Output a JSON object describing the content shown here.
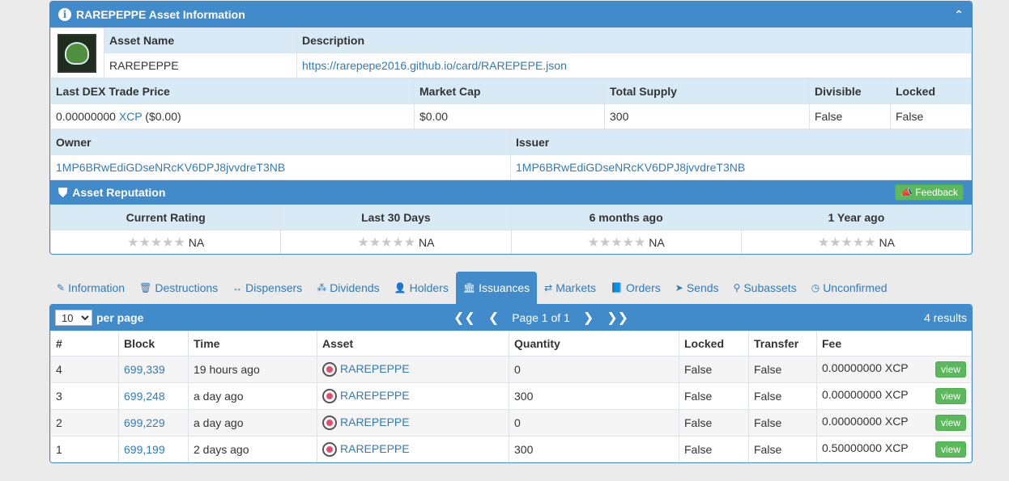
{
  "info": {
    "title": "RAREPEPPE Asset Information",
    "asset_name_label": "Asset Name",
    "description_label": "Description",
    "asset_name": "RAREPEPPE",
    "description": "https://rarepepe2016.github.io/card/RAREPEPE.json",
    "last_dex_label": "Last DEX Trade Price",
    "market_cap_label": "Market Cap",
    "total_supply_label": "Total Supply",
    "divisible_label": "Divisible",
    "locked_label": "Locked",
    "last_dex_value": "0.00000000",
    "last_dex_unit": "XCP",
    "last_dex_usd": "($0.00)",
    "market_cap": "$0.00",
    "total_supply": "300",
    "divisible": "False",
    "locked": "False",
    "owner_label": "Owner",
    "issuer_label": "Issuer",
    "owner": "1MP6BRwEdiGDseNRcKV6DPJ8jvvdreT3NB",
    "issuer": "1MP6BRwEdiGDseNRcKV6DPJ8jvvdreT3NB"
  },
  "reputation": {
    "title": "Asset Reputation",
    "feedback_label": "Feedback",
    "stars": "★★★★★",
    "columns": [
      {
        "label": "Current Rating",
        "value": "NA"
      },
      {
        "label": "Last 30 Days",
        "value": "NA"
      },
      {
        "label": "6 months ago",
        "value": "NA"
      },
      {
        "label": "1 Year ago",
        "value": "NA"
      }
    ]
  },
  "tabs": [
    {
      "icon": "✎",
      "label": "Information"
    },
    {
      "icon": "🗑",
      "label": "Destructions"
    },
    {
      "icon": "↔",
      "label": "Dispensers"
    },
    {
      "icon": "⁂",
      "label": "Dividends"
    },
    {
      "icon": "👤",
      "label": "Holders"
    },
    {
      "icon": "🏛",
      "label": "Issuances"
    },
    {
      "icon": "⇄",
      "label": "Markets"
    },
    {
      "icon": "📘",
      "label": "Orders"
    },
    {
      "icon": "➤",
      "label": "Sends"
    },
    {
      "icon": "⚲",
      "label": "Subassets"
    },
    {
      "icon": "◷",
      "label": "Unconfirmed"
    }
  ],
  "issuances": {
    "per_page_value": "10",
    "per_page_label": "per page",
    "page_label": "Page 1 of 1",
    "results": "4 results",
    "headers": {
      "num": "#",
      "block": "Block",
      "time": "Time",
      "asset": "Asset",
      "quantity": "Quantity",
      "locked": "Locked",
      "transfer": "Transfer",
      "fee": "Fee"
    },
    "view_label": "view",
    "rows": [
      {
        "num": "4",
        "block": "699,339",
        "time": "19 hours ago",
        "asset": "RAREPEPPE",
        "quantity": "0",
        "locked": "False",
        "transfer": "False",
        "fee": "0.00000000 XCP"
      },
      {
        "num": "3",
        "block": "699,248",
        "time": "a day ago",
        "asset": "RAREPEPPE",
        "quantity": "300",
        "locked": "False",
        "transfer": "False",
        "fee": "0.00000000 XCP"
      },
      {
        "num": "2",
        "block": "699,229",
        "time": "a day ago",
        "asset": "RAREPEPPE",
        "quantity": "0",
        "locked": "False",
        "transfer": "False",
        "fee": "0.00000000 XCP"
      },
      {
        "num": "1",
        "block": "699,199",
        "time": "2 days ago",
        "asset": "RAREPEPPE",
        "quantity": "300",
        "locked": "False",
        "transfer": "False",
        "fee": "0.50000000 XCP"
      }
    ]
  }
}
